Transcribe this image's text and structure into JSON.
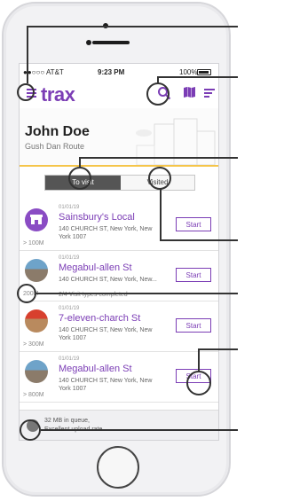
{
  "status_bar": {
    "carrier": "●●○○○ AT&T",
    "time": "9:23 PM",
    "battery": "100%"
  },
  "app": {
    "logo": "trax"
  },
  "icons": {
    "menu": "menu-icon",
    "search": "search-icon",
    "map": "map-icon",
    "sort": "sort-icon",
    "upload": "upload-icon"
  },
  "colors": {
    "brand": "#7b3db5",
    "accent": "#f5c54a",
    "tab_active": "#555555"
  },
  "route": {
    "user": "John Doe",
    "route": "Gush Dan Route"
  },
  "tabs": {
    "to_visit": "To visit",
    "visited": "Visited"
  },
  "stores": [
    {
      "date": "01/01/19",
      "name": "Sainsbury's Local",
      "address": "140 CHURCH ST, New York, New York 1007",
      "extra": "",
      "distance": "> 100M",
      "action": "Start"
    },
    {
      "date": "01/01/19",
      "name": "Megabul-allen St",
      "address": "140 CHURCH ST, New York, New...",
      "extra": "2/4 Visit types completed",
      "distance": "200M",
      "action": "Start"
    },
    {
      "date": "01/01/19",
      "name": "7-eleven-charch St",
      "address": "140 CHURCH ST, New York, New York 1007",
      "extra": "",
      "distance": "> 300M",
      "action": "Start"
    },
    {
      "date": "01/01/19",
      "name": "Megabul-allen St",
      "address": "140 CHURCH ST, New York, New York 1007",
      "extra": "",
      "distance": "> 800M",
      "action": "Start"
    }
  ],
  "upload": {
    "line1": "32 MB in queue,",
    "line2": "Excellent upload rate"
  }
}
